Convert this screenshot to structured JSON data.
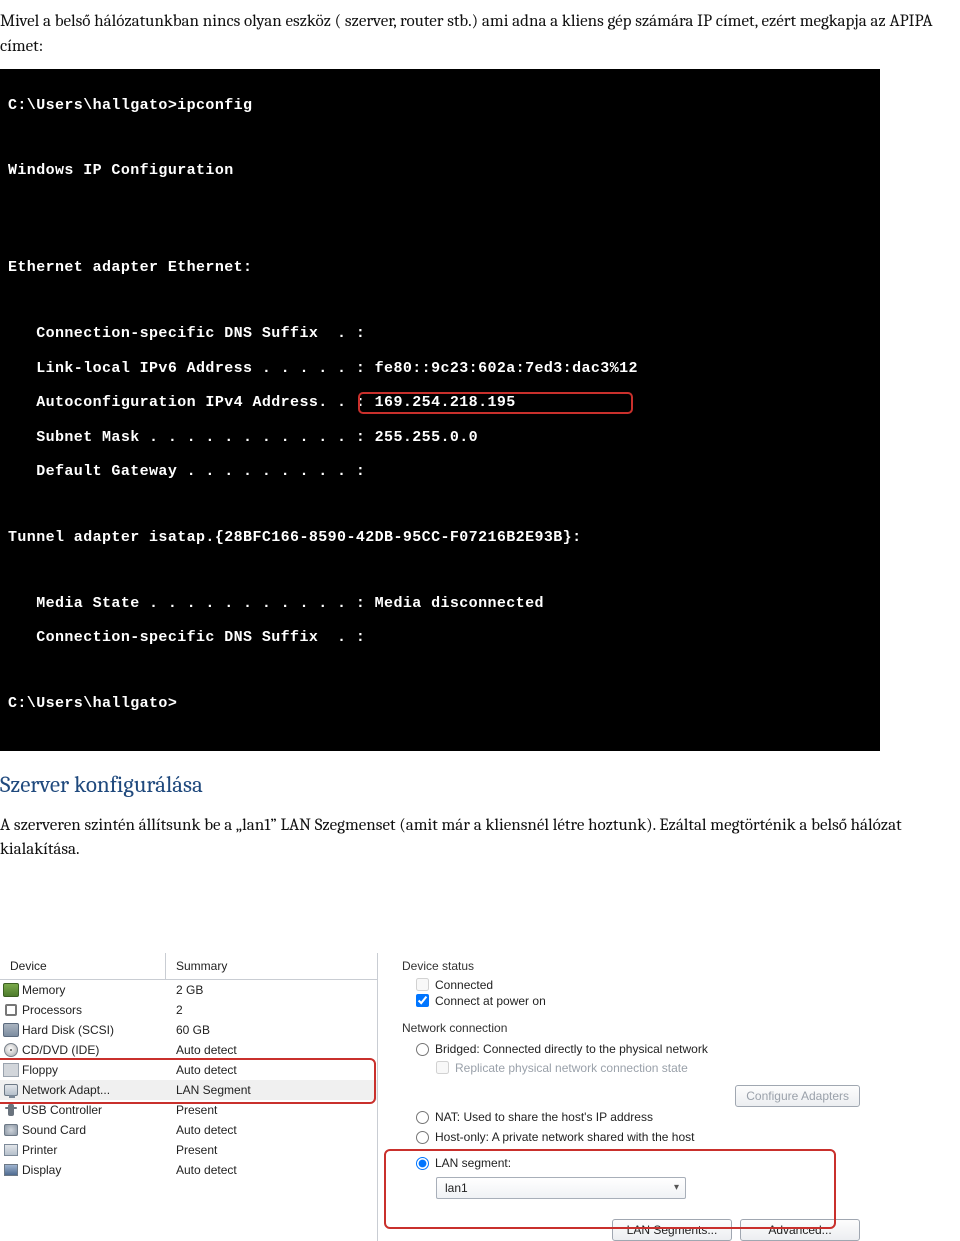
{
  "intro": {
    "p1": "Mivel a belső hálózatunkban nincs olyan eszköz ( szerver, router stb.) ami adna a kliens gép számára IP címet, ezért megkapja az APIPA címet:"
  },
  "terminal": {
    "l1": "C:\\Users\\hallgato>ipconfig",
    "l3": "Windows IP Configuration",
    "l6": "Ethernet adapter Ethernet:",
    "l8": "   Connection-specific DNS Suffix  . :",
    "l9": "   Link-local IPv6 Address . . . . . : fe80::9c23:602a:7ed3:dac3%12",
    "l10": "   Autoconfiguration IPv4 Address. . : 169.254.218.195",
    "l11": "   Subnet Mask . . . . . . . . . . . : 255.255.0.0",
    "l12": "   Default Gateway . . . . . . . . . :",
    "l14": "Tunnel adapter isatap.{28BFC166-8590-42DB-95CC-F07216B2E93B}:",
    "l16": "   Media State . . . . . . . . . . . : Media disconnected",
    "l17": "   Connection-specific DNS Suffix  . :",
    "l19": "C:\\Users\\hallgato>"
  },
  "heading": "Szerver konfigurálása",
  "body2": "A szerveren szintén állítsunk be a „lan1” LAN Szegmenset (amit már a kliensnél létre hoztunk). Ezáltal megtörténik a belső hálózat kialakítása.",
  "vm": {
    "headers": {
      "device": "Device",
      "summary": "Summary"
    },
    "rows": [
      {
        "icon": "ic-mem",
        "device": "Memory",
        "summary": "2 GB"
      },
      {
        "icon": "ic-cpu",
        "device": "Processors",
        "summary": "2"
      },
      {
        "icon": "ic-hdd",
        "device": "Hard Disk (SCSI)",
        "summary": "60 GB"
      },
      {
        "icon": "ic-cd",
        "device": "CD/DVD (IDE)",
        "summary": "Auto detect"
      },
      {
        "icon": "ic-flp",
        "device": "Floppy",
        "summary": "Auto detect"
      },
      {
        "icon": "ic-net",
        "device": "Network Adapt...",
        "summary": "LAN Segment",
        "selected": true
      },
      {
        "icon": "ic-usb",
        "device": "USB Controller",
        "summary": "Present"
      },
      {
        "icon": "ic-snd",
        "device": "Sound Card",
        "summary": "Auto detect"
      },
      {
        "icon": "ic-prn",
        "device": "Printer",
        "summary": "Present"
      },
      {
        "icon": "ic-dsp",
        "device": "Display",
        "summary": "Auto detect"
      }
    ],
    "right": {
      "status_label": "Device status",
      "connected": "Connected",
      "connect_poweron": "Connect at power on",
      "net_label": "Network connection",
      "bridged": "Bridged: Connected directly to the physical network",
      "replicate": "Replicate physical network connection state",
      "configure_adapters": "Configure Adapters",
      "nat": "NAT: Used to share the host's IP address",
      "hostonly": "Host-only: A private network shared with the host",
      "lanseg": "LAN segment:",
      "lanseg_value": "lan1",
      "btn_lanseg": "LAN Segments...",
      "btn_adv": "Advanced..."
    }
  }
}
